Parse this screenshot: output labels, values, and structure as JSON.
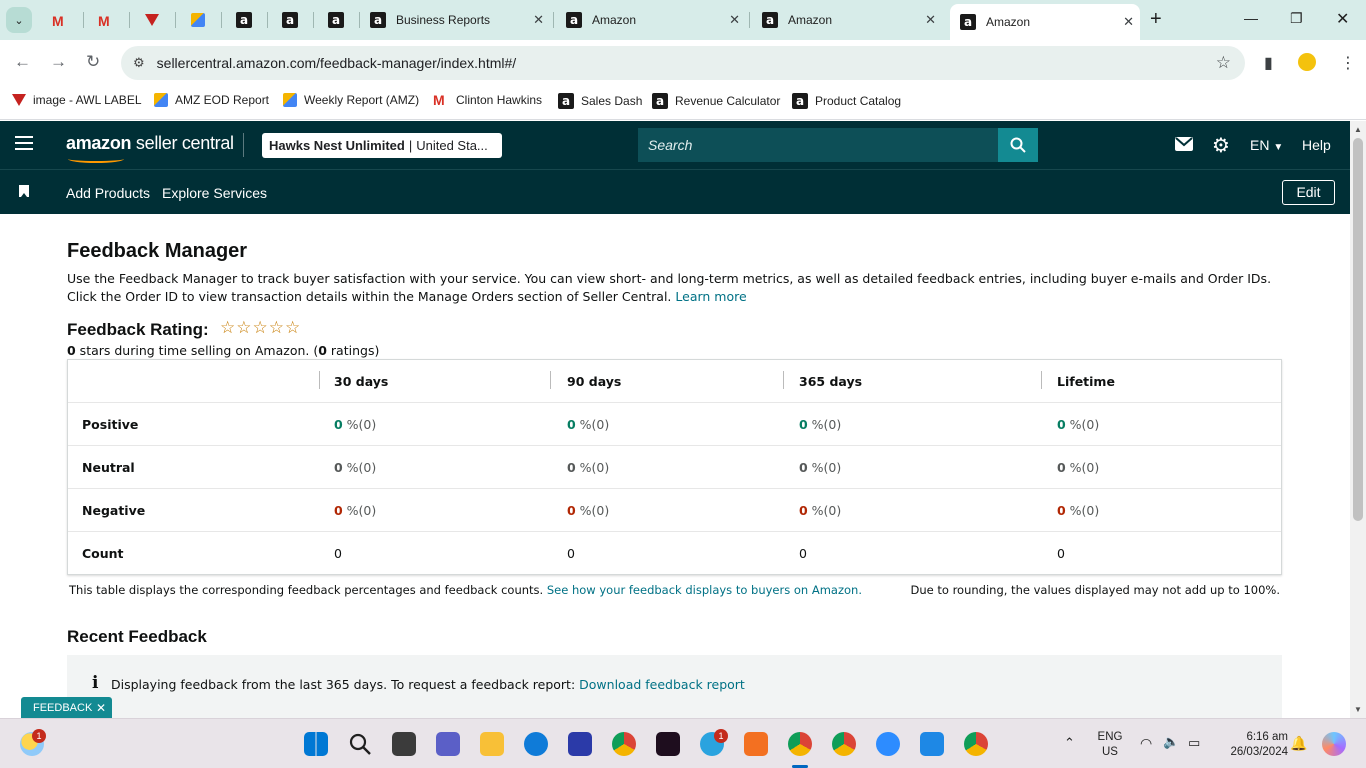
{
  "browser": {
    "tabs": [
      {
        "title": "Business Reports",
        "favicon": "amazon-a-icon"
      },
      {
        "title": "Amazon",
        "favicon": "amazon-a-icon"
      },
      {
        "title": "Amazon",
        "favicon": "amazon-a-icon"
      },
      {
        "title": "Amazon",
        "favicon": "amazon-a-icon",
        "active": true
      }
    ],
    "url": "sellercentral.amazon.com/feedback-manager/index.html#/",
    "bookmarks": [
      {
        "label": "image - AWL LABEL"
      },
      {
        "label": "AMZ EOD Report"
      },
      {
        "label": "Weekly Report (AMZ)"
      },
      {
        "label": "Clinton Hawkins"
      },
      {
        "label": "Sales Dash"
      },
      {
        "label": "Revenue Calculator"
      },
      {
        "label": "Product Catalog"
      }
    ]
  },
  "header": {
    "logo_amazon": "amazon",
    "logo_rest": " seller central",
    "account_name": "Hawks Nest Unlimited",
    "account_sep": "|",
    "account_region": "United Sta...",
    "search_placeholder": "Search",
    "language": "EN",
    "help": "Help"
  },
  "subnav": {
    "links": [
      "Add Products",
      "Explore Services"
    ],
    "edit": "Edit"
  },
  "page": {
    "title": "Feedback Manager",
    "intro": "Use the Feedback Manager to track buyer satisfaction with your service. You can view short- and long-term metrics, as well as detailed feedback entries, including buyer e-mails and Order IDs. Click the Order ID to view transaction details within the Manage Orders section of Seller Central.",
    "learn_more": "Learn more",
    "rating_title": "Feedback Rating:",
    "stars": "☆☆☆☆☆",
    "stars_count": "0",
    "stars_text": " stars during time selling on Amazon. (",
    "ratings_count": "0",
    "ratings_text": " ratings)",
    "table": {
      "columns": [
        "30 days",
        "90 days",
        "365 days",
        "Lifetime"
      ],
      "rows": [
        {
          "label": "Positive",
          "cells": [
            {
              "n": "0",
              "p": " %(0)"
            },
            {
              "n": "0",
              "p": " %(0)"
            },
            {
              "n": "0",
              "p": " %(0)"
            },
            {
              "n": "0",
              "p": " %(0)"
            }
          ]
        },
        {
          "label": "Neutral",
          "cells": [
            {
              "n": "0",
              "p": " %(0)"
            },
            {
              "n": "0",
              "p": " %(0)"
            },
            {
              "n": "0",
              "p": " %(0)"
            },
            {
              "n": "0",
              "p": " %(0)"
            }
          ]
        },
        {
          "label": "Negative",
          "cells": [
            {
              "n": "0",
              "p": " %(0)"
            },
            {
              "n": "0",
              "p": " %(0)"
            },
            {
              "n": "0",
              "p": " %(0)"
            },
            {
              "n": "0",
              "p": " %(0)"
            }
          ]
        },
        {
          "label": "Count",
          "cells": [
            {
              "n": "0"
            },
            {
              "n": "0"
            },
            {
              "n": "0"
            },
            {
              "n": "0"
            }
          ]
        }
      ]
    },
    "footnote_left": "This table displays the corresponding feedback percentages and feedback counts.",
    "footnote_link": "See how your feedback displays to buyers on Amazon.",
    "footnote_right": "Due to rounding, the values displayed may not add up to 100%.",
    "recent_title": "Recent Feedback",
    "info_text": "Displaying feedback from the last 365 days. To request a feedback report:",
    "info_link": "Download feedback report",
    "feedback_tab": "FEEDBACK"
  },
  "taskbar": {
    "weather_badge": "1",
    "telegram_badge": "1",
    "lang_line1": "ENG",
    "lang_line2": "US",
    "time": "6:16 am",
    "date": "26/03/2024"
  },
  "colors": {
    "header_bg": "#002f36",
    "accent_teal": "#138a92",
    "link": "#007185",
    "positive": "#067d62",
    "negative": "#b12704",
    "star": "#c77c02"
  }
}
